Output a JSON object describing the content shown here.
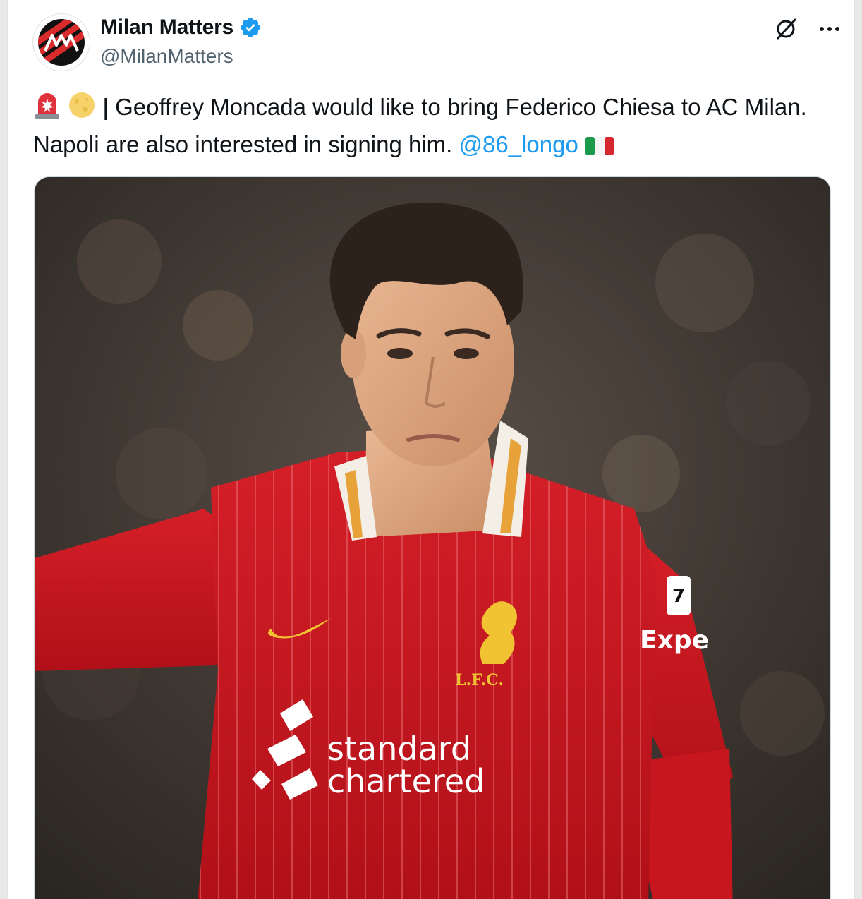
{
  "account": {
    "display_name": "Milan Matters",
    "handle": "@MilanMatters",
    "verified": true,
    "avatar_icon": "milan-matters-logo"
  },
  "icons": {
    "grok": "grok-icon",
    "more": "more-options-icon",
    "alert": "rotating-light-emoji",
    "moon": "full-moon-emoji",
    "flag": "italy-flag-emoji"
  },
  "tweet": {
    "text_main": "| Geoffrey Moncada would like to bring Federico Chiesa to AC Milan. Napoli are also interested in signing him.",
    "mention": "@86_longo"
  },
  "media": {
    "crest_text": "L.F.C.",
    "sponsor_line1": "standard",
    "sponsor_line2": "chartered",
    "sleeve_text": "Expe",
    "sleeve_badge": "7"
  },
  "colors": {
    "accent": "#1d9bf0",
    "verified": "#1d9bf0",
    "shirt_red": "#c8161f",
    "avatar_red": "#d92b2b"
  }
}
